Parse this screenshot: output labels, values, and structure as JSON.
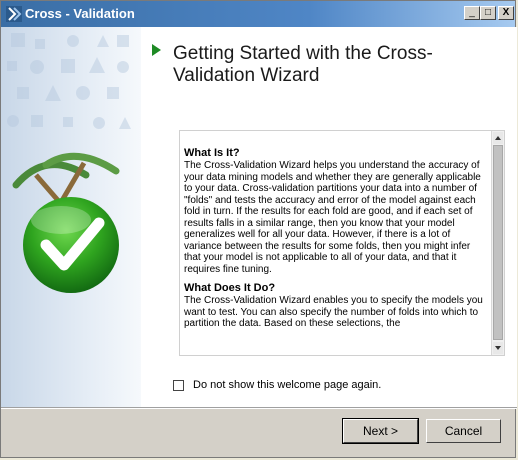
{
  "window": {
    "title": "Cross - Validation",
    "controls": {
      "minimize": "_",
      "maximize": "□",
      "close": "X"
    }
  },
  "header": {
    "title": "Getting Started with the Cross-Validation Wizard",
    "arrow_color": "#1e8a24"
  },
  "side_panel": {
    "illustration": "green-checkmark-with-pickaxes"
  },
  "info": {
    "sections": [
      {
        "heading": "What Is It?",
        "body": "The Cross-Validation Wizard helps you understand the accuracy of your data mining models and whether they are generally applicable to your data. Cross-validation partitions your data into a number of \"folds\" and tests the accuracy and error of the model against each fold in turn. If the results for each fold are good, and if each set of results falls in a similar range, then you know that your model generalizes well for all your data. However, if there is a lot of variance between the results for some folds, then you might infer that your model is not applicable to all of your data, and that it requires fine tuning."
      },
      {
        "heading": "What Does It Do?",
        "body": "The Cross-Validation Wizard enables you to specify the models you want to test. You can also specify the number of folds into which to partition the data. Based on these selections, the"
      }
    ]
  },
  "checkbox": {
    "label": "Do not show this welcome page again.",
    "checked": false
  },
  "buttons": {
    "next": "Next >",
    "cancel": "Cancel"
  }
}
